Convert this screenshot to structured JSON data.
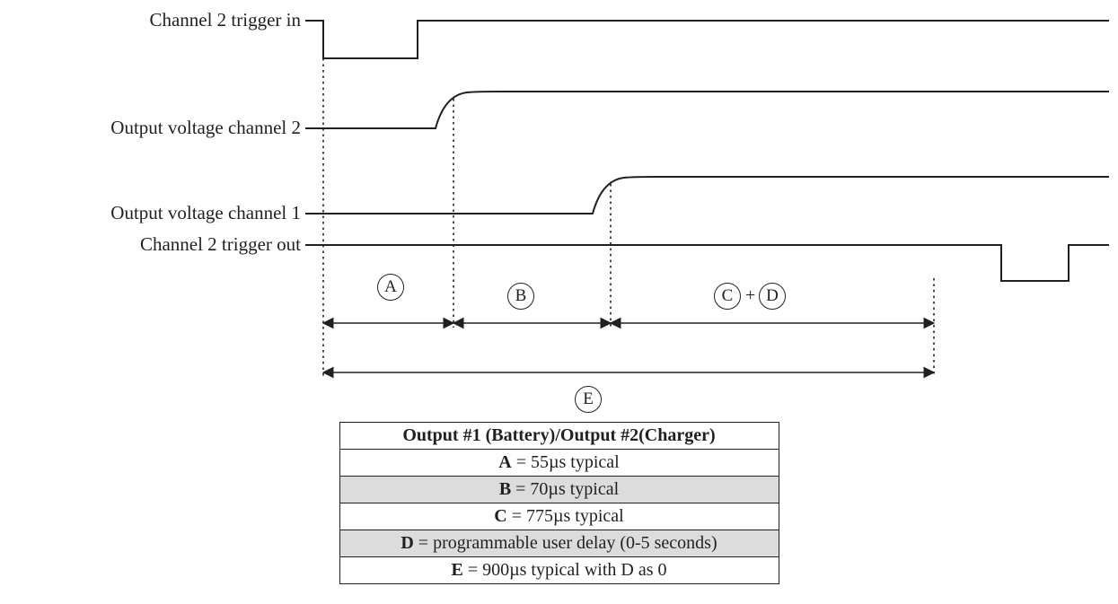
{
  "signals": {
    "label1": "Channel 2 trigger in",
    "label2": "Output voltage channel 2",
    "label3": "Output voltage channel 1",
    "label4": "Channel 2 trigger out"
  },
  "markers": {
    "A": "A",
    "B": "B",
    "C": "C",
    "D": "D",
    "E": "E",
    "plus": "+"
  },
  "table": {
    "header": "Output #1 (Battery)/Output #2(Charger)",
    "rowA_key": "A",
    "rowA_val": " = 55µs typical",
    "rowB_key": "B",
    "rowB_val": " = 70µs typical",
    "rowC_key": "C",
    "rowC_val": " = 775µs typical",
    "rowD_key": "D",
    "rowD_val": " = programmable user delay (0-5 seconds)",
    "rowE_key": "E",
    "rowE_val": " = 900µs typical with D as 0"
  }
}
